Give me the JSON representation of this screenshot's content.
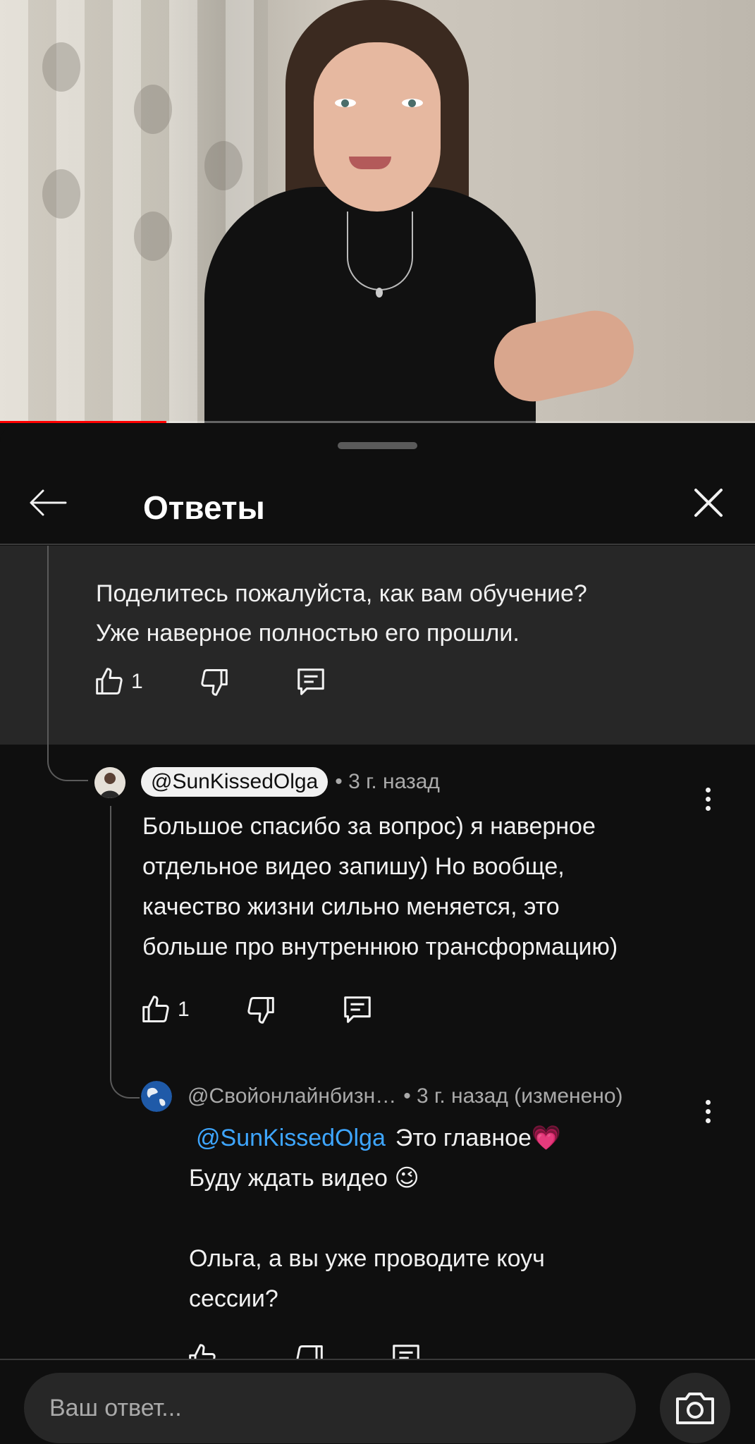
{
  "video": {
    "progress_fraction": 0.22
  },
  "header": {
    "title": "Ответы"
  },
  "parent_comment": {
    "text_line1": "Поделитесь пожалуйста, как вам обучение?",
    "text_line2": "Уже наверное полностью его прошли.",
    "likes": "1"
  },
  "replies": [
    {
      "author": "@SunKissedOlga",
      "time": "• 3 г. назад",
      "lines": [
        "Большое спасибо за вопрос) я наверное",
        "отдельное видео запишу) Но вообще,",
        "качество жизни сильно меняется, это",
        "больше про внутреннюю трансформацию)"
      ],
      "likes": "1"
    },
    {
      "author": "@Свойонлайнбизн…",
      "time": "• 3 г. назад (изменено)",
      "mention": "@SunKissedOlga",
      "line1": "Это главное💗",
      "line2": "Буду ждать видео 😉",
      "line3": "Ольга, а вы уже проводите коуч",
      "line4": "сессии?"
    }
  ],
  "input": {
    "placeholder": "Ваш ответ..."
  },
  "icons": {
    "back": "arrow-left-icon",
    "close": "close-icon",
    "like": "thumb-up-icon",
    "dislike": "thumb-down-icon",
    "reply": "reply-comment-icon",
    "more": "more-vert-icon",
    "camera": "camera-icon"
  },
  "colors": {
    "background": "#0f0f0f",
    "surface": "#272727",
    "mention": "#3ea6ff",
    "progress": "#ff0000"
  }
}
